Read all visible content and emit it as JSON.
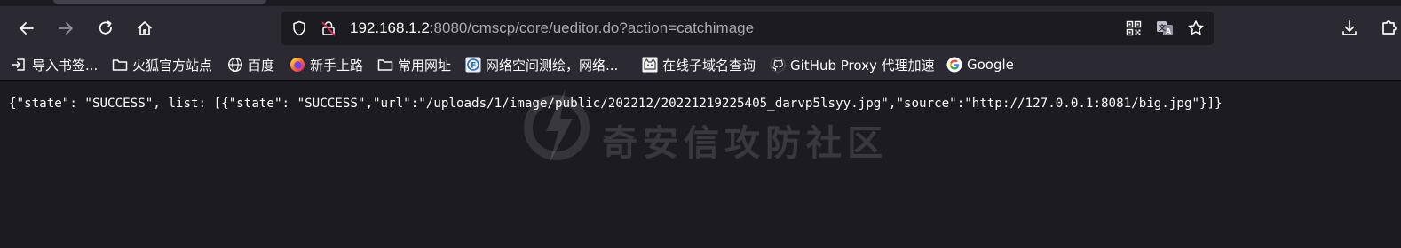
{
  "browser": {
    "nav": {
      "back": "back-icon",
      "forward": "forward-icon",
      "reload": "reload-icon",
      "home": "home-icon"
    },
    "urlbar": {
      "host": "192.168.1.2",
      "rest": ":8080/cmscp/core/ueditor.do?action=catchimage"
    }
  },
  "bookmarks": [
    {
      "label": "导入书签...",
      "icon": "import-icon"
    },
    {
      "label": "火狐官方站点",
      "icon": "folder-icon"
    },
    {
      "label": "百度",
      "icon": "globe-icon"
    },
    {
      "label": "新手上路",
      "icon": "firefox-icon"
    },
    {
      "label": "常用网址",
      "icon": "folder-icon"
    },
    {
      "label": "网络空间测绘，网络...",
      "icon": "fofa-icon"
    },
    {
      "label": "在线子域名查询",
      "icon": "cat-icon"
    },
    {
      "label": "GitHub Proxy 代理加速",
      "icon": "github-icon"
    },
    {
      "label": "Google",
      "icon": "google-icon"
    }
  ],
  "page": {
    "body_text": "{\"state\": \"SUCCESS\", list: [{\"state\": \"SUCCESS\",\"url\":\"/uploads/1/image/public/202212/20221219225405_darvp5lsyy.jpg\",\"source\":\"http://127.0.0.1:8081/big.jpg\"}]}",
    "watermark": "奇安信攻防社区"
  },
  "colors": {
    "chrome": "#2b2a33",
    "content_bg": "#1c1b22",
    "text": "#fbfbfe"
  }
}
